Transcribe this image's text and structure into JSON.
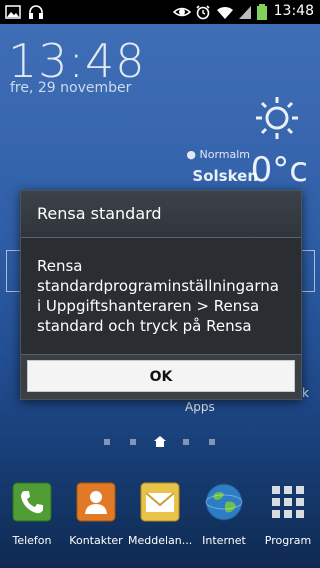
{
  "status_bar": {
    "time": "13:48",
    "icons": [
      "gallery-icon",
      "headphones-icon",
      "eye-icon",
      "alarm-icon",
      "wifi-icon",
      "signal-icon",
      "battery-icon"
    ]
  },
  "widget": {
    "clock_time": "13:48",
    "date": "fre, 29 november",
    "location": "Normalm",
    "condition": "Solsken",
    "temperature": "0°c"
  },
  "dialog": {
    "title": "Rensa standard",
    "body": "Rensa standardprograminställningarna i Uppgiftshanteraren > Rensa standard och tryck på Rensa",
    "ok_label": "OK"
  },
  "home": {
    "apps_label": "Apps",
    "partial_label": "k"
  },
  "dock": [
    {
      "label": "Telefon",
      "icon": "phone-icon"
    },
    {
      "label": "Kontakter",
      "icon": "contacts-icon"
    },
    {
      "label": "Meddelan...",
      "icon": "messages-icon"
    },
    {
      "label": "Internet",
      "icon": "globe-icon"
    },
    {
      "label": "Program",
      "icon": "apps-grid-icon"
    }
  ]
}
